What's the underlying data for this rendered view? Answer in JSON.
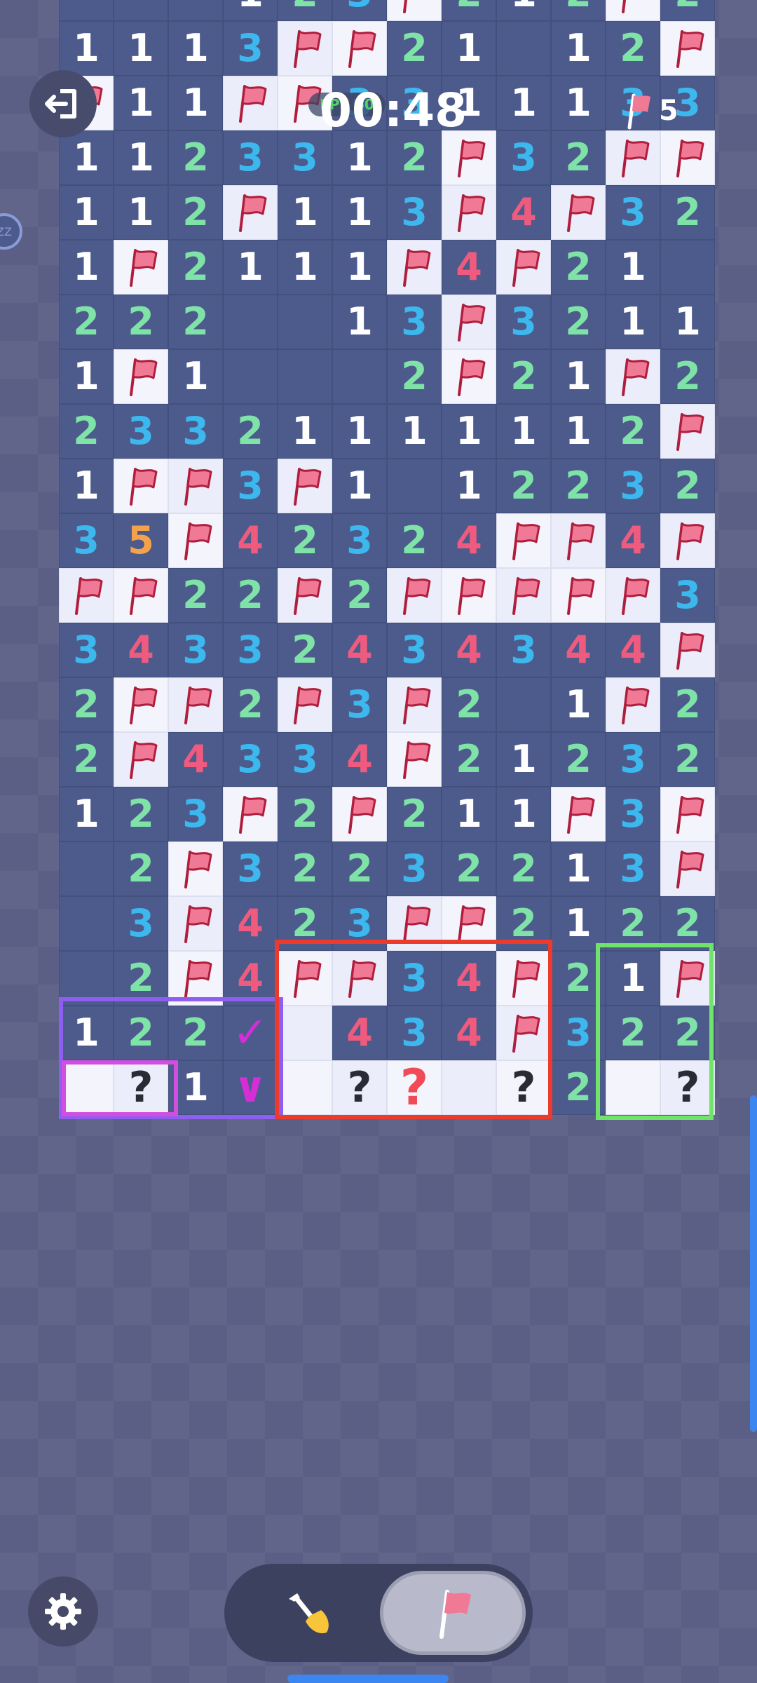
{
  "hud": {
    "timer": "00:48",
    "timer_badge": "FPS 60",
    "flags_left": "5",
    "side_badge": "ZZ"
  },
  "board": {
    "cols": 12,
    "rows": [
      ". . . 1 2 3 F 2 1 2 F 2",
      "1 1 1 3 F F 2 1 . 1 2 F",
      "F 1 1 F F 3 3 1 1 1 3 3",
      "1 1 2 3 3 1 2 F 3 2 F F",
      "1 1 2 F 1 1 3 F 4 F 3 2",
      "1 F 2 1 1 1 F 4 F 2 1 .",
      "2 2 2 . . 1 3 F 3 2 1 1",
      "1 F 1 . . . 2 F 2 1 F 2",
      "2 3 3 2 1 1 1 1 1 1 2 F",
      "1 F F 3 F 1 . 1 2 2 3 2",
      "3 5 F 4 2 3 2 4 F F 4 F",
      "F F 2 2 F 2 F F F F F 3",
      "3 4 3 3 2 4 3 4 3 4 4 F",
      "2 F F 2 F 3 F 2 . 1 F 2",
      "2 F 4 3 3 4 F 2 1 2 3 2",
      "1 2 3 F 2 F 2 1 1 F 3 F",
      ". 2 F 3 2 2 3 2 2 1 3 F",
      ". 3 F 4 2 3 F F 2 1 2 2",
      ". 2 F 4 F F 3 4 F 2 1 F",
      "1 2 2 V H 4 3 4 F 3 2 2",
      "H ? 1 W H ? R H ? 2 H ?"
    ]
  },
  "highlights": [
    {
      "name": "purple-highlight-box",
      "color": "#8e5ef0"
    },
    {
      "name": "magenta-highlight-box",
      "color": "#d14ee0"
    },
    {
      "name": "red-highlight-box",
      "color": "#ec3b2d"
    },
    {
      "name": "green-highlight-box",
      "color": "#6fe36a"
    }
  ],
  "colors": {
    "number_1": "#ffffff",
    "number_2": "#7fe3a8",
    "number_3": "#3db8ee",
    "number_4": "#ee5b7f",
    "number_5": "#f5a14c",
    "flag": "#f07a95",
    "question": "#2b2b36",
    "question_red": "#ef4a55",
    "check_mark": "#d62ed6",
    "accent": "#3b86f0"
  },
  "icons": {
    "exit": "exit-icon",
    "settings": "gear-icon",
    "dig": "shovel-icon",
    "flag_mode": "flag-icon",
    "flag_counter": "flag-icon"
  },
  "mode": {
    "active": "flag"
  }
}
